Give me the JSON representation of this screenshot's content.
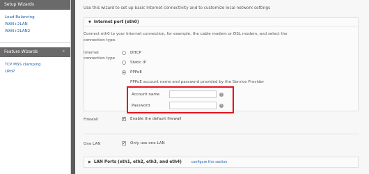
{
  "sidebar": {
    "setup_header": "Setup Wizards",
    "setup_items": [
      {
        "label": "Load Balancing"
      },
      {
        "label": "WAN+2LAN"
      },
      {
        "label": "WAN+2LAN2"
      }
    ],
    "feature_header": "Feature Wizards",
    "feature_collapse": "«",
    "feature_items": [
      {
        "label": "TCP MSS clamping"
      },
      {
        "label": "UPnP"
      }
    ]
  },
  "main": {
    "intro": "Use this wizard to set up basic Internet connectivity and to customize local network settings",
    "internet_port": {
      "title": "Internet port (eth0)",
      "description": "Connect eth0 to your Internet connection, for example, the cable modem or DSL modem, and select the connection type.",
      "conn_type_label": "Internet connection type",
      "options": [
        {
          "label": "DHCP",
          "selected": false
        },
        {
          "label": "Static IP",
          "selected": false
        },
        {
          "label": "PPPoE",
          "selected": true
        }
      ],
      "pppoe_note": "PPPoE account name and password provided by the Service Provider",
      "account_label": "Account name",
      "account_value": "",
      "password_label": "Password",
      "password_value": ""
    },
    "firewall": {
      "label": "Firewall",
      "checkbox_text": "Enable the default firewall",
      "checked": true
    },
    "one_lan": {
      "label": "One LAN",
      "checkbox_text": "Only use one LAN",
      "checked": true
    },
    "lan_ports": {
      "title": "LAN Ports (eth1, eth2, eth3, and eth4)",
      "link": "configure this section"
    }
  },
  "colors": {
    "highlight": "#e3141e",
    "link": "#1f5fa8",
    "sidebar_header": "#6a6a6a"
  }
}
